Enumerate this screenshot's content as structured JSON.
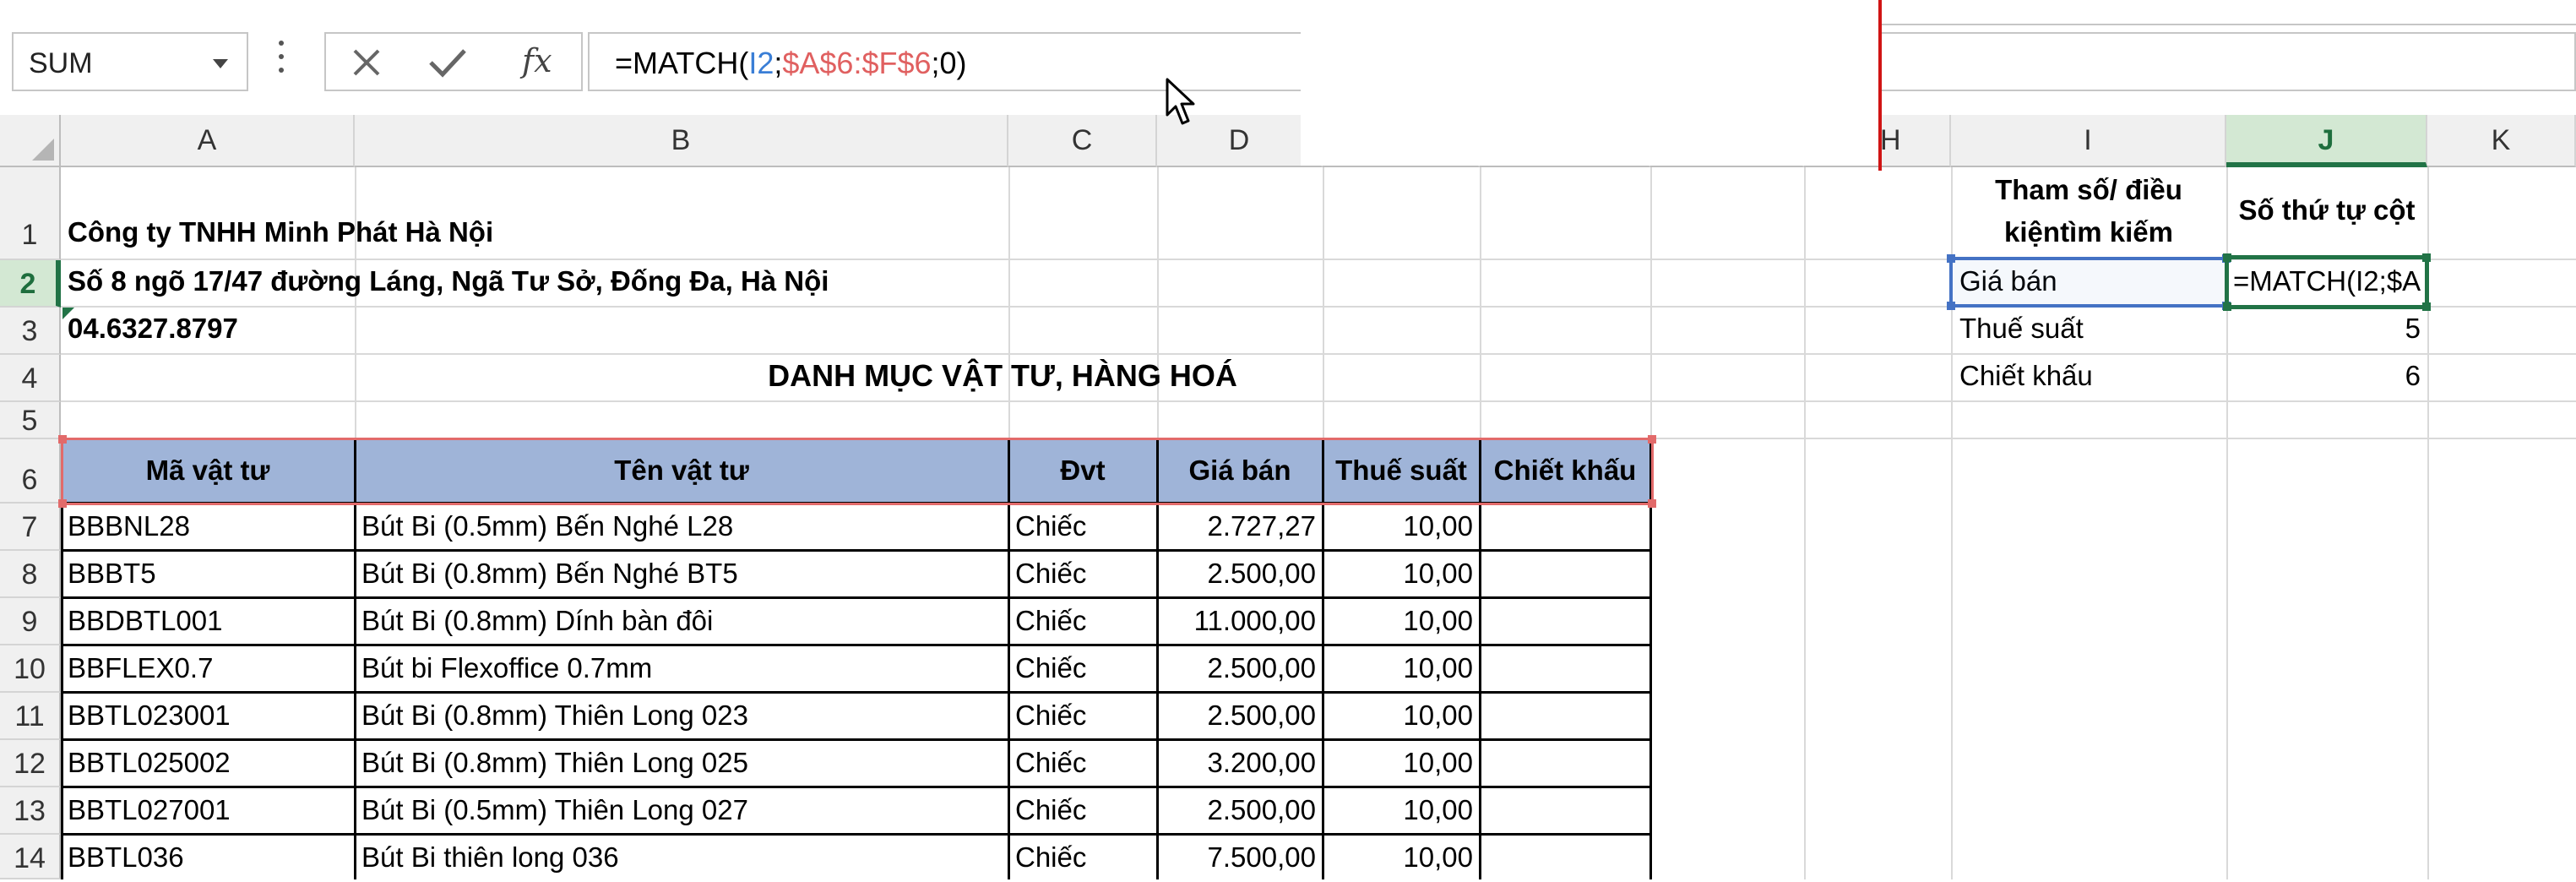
{
  "name_box": {
    "value": "SUM"
  },
  "formula_bar": {
    "fx_label": "fx",
    "parts": [
      {
        "text": "=MATCH(",
        "color": "black"
      },
      {
        "text": "I2",
        "color": "blue"
      },
      {
        "text": ";",
        "color": "black"
      },
      {
        "text": "$A$6:$F$6",
        "color": "red"
      },
      {
        "text": ";0)",
        "color": "black"
      }
    ]
  },
  "columns": [
    "A",
    "B",
    "C",
    "D",
    "H",
    "I",
    "J",
    "K"
  ],
  "rows": [
    "1",
    "2",
    "3",
    "4",
    "5",
    "6",
    "7",
    "8",
    "9",
    "10",
    "11",
    "12",
    "13",
    "14"
  ],
  "company": {
    "name": "Công ty TNHH  Minh Phát Hà Nội",
    "address": "Số 8 ngõ 17/47 đường Láng, Ngã Tư Sở, Đống Đa, Hà Nội",
    "phone": "04.6327.8797",
    "title": "DANH MỤC VẬT TƯ, HÀNG HOÁ"
  },
  "table": {
    "headers": [
      "Mã vật tư",
      "Tên vật tư",
      "Đvt",
      "Giá bán",
      "Thuế suất",
      "Chiết khấu"
    ],
    "rows": [
      [
        "BBBNL28",
        "Bút Bi (0.5mm) Bến Nghé L28",
        "Chiếc",
        "2.727,27",
        "10,00",
        ""
      ],
      [
        "BBBT5",
        "Bút Bi (0.8mm) Bến Nghé BT5",
        "Chiếc",
        "2.500,00",
        "10,00",
        ""
      ],
      [
        "BBDBTL001",
        "Bút Bi (0.8mm) Dính bàn đôi",
        "Chiếc",
        "11.000,00",
        "10,00",
        ""
      ],
      [
        "BBFLEX0.7",
        "Bút bi Flexoffice 0.7mm",
        "Chiếc",
        "2.500,00",
        "10,00",
        ""
      ],
      [
        "BBTL023001",
        "Bút Bi (0.8mm) Thiên Long 023",
        "Chiếc",
        "2.500,00",
        "10,00",
        ""
      ],
      [
        "BBTL025002",
        "Bút Bi (0.8mm) Thiên Long 025",
        "Chiếc",
        "3.200,00",
        "10,00",
        ""
      ],
      [
        "BBTL027001",
        "Bút Bi (0.5mm) Thiên Long 027",
        "Chiếc",
        "2.500,00",
        "10,00",
        ""
      ],
      [
        "BBTL036",
        "Bút Bi thiên long 036",
        "Chiếc",
        "7.500,00",
        "10,00",
        ""
      ]
    ]
  },
  "lookup": {
    "header_param_line1": "Tham số/ điều",
    "header_param_line2": "kiệntìm kiếm",
    "header_col": "Số thứ tự cột",
    "rows": [
      {
        "label": "Giá bán",
        "value": "=MATCH(I2;$A"
      },
      {
        "label": "Thuế suất",
        "value": "5"
      },
      {
        "label": "Chiết khấu",
        "value": "6"
      }
    ]
  },
  "colors": {
    "header_fill": "#9fb4d8",
    "selection_green": "#217346",
    "ref_blue": "#3a7ed6",
    "ref_red": "#e06060"
  }
}
